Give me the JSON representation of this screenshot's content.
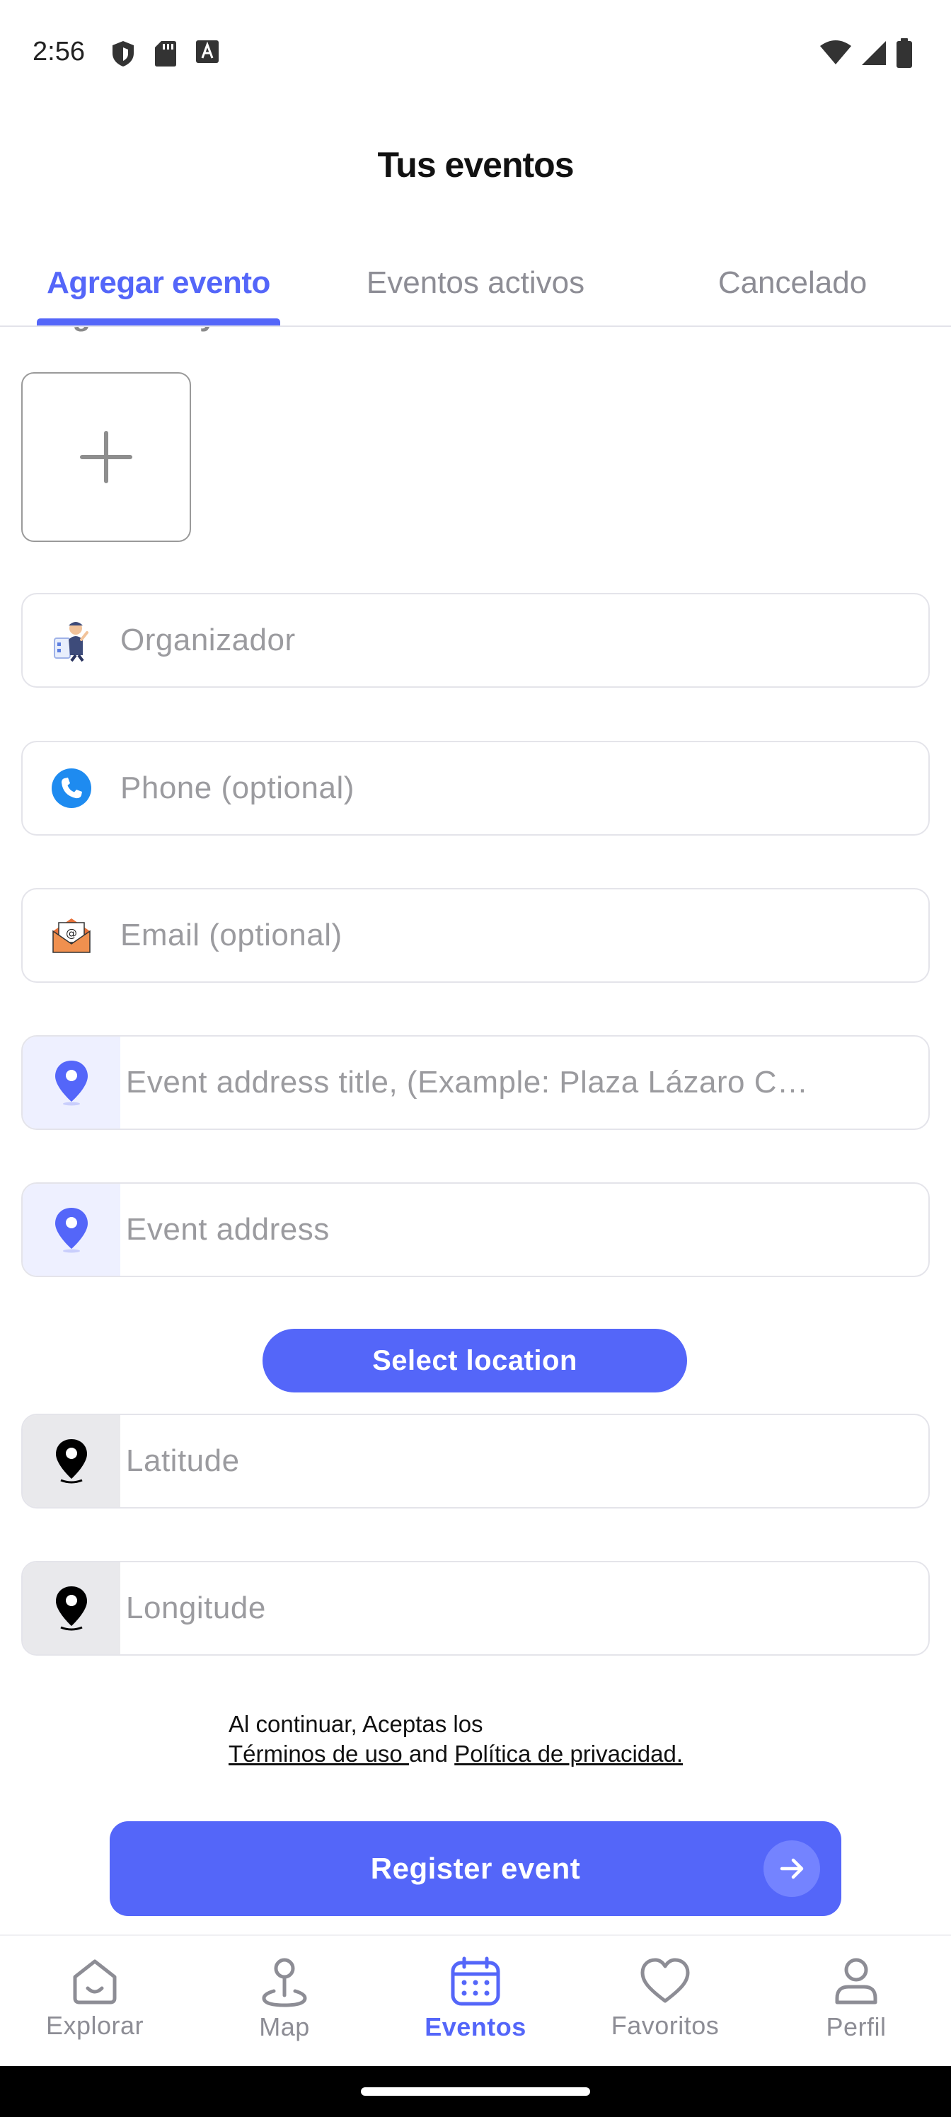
{
  "status_bar": {
    "time": "2:56",
    "left_icons": [
      "shield-icon",
      "sd-card-icon",
      "font-icon"
    ],
    "right_icons": [
      "wifi-icon",
      "signal-icon",
      "battery-icon"
    ]
  },
  "header": {
    "title": "Tus eventos"
  },
  "tabs": [
    {
      "label": "Agregar evento",
      "active": true
    },
    {
      "label": "Eventos activos",
      "active": false
    },
    {
      "label": "Cancelado",
      "active": false
    }
  ],
  "form": {
    "gallery_label": "Image Gallery",
    "add_image_icon": "plus-icon",
    "fields": {
      "organizer": {
        "placeholder": "Organizador",
        "icon": "organizer-icon"
      },
      "phone": {
        "placeholder": "Phone (optional)",
        "icon": "phone-icon"
      },
      "email": {
        "placeholder": "Email (optional)",
        "icon": "email-icon"
      },
      "address_title": {
        "placeholder": "Event address title, (Example: Plaza Lázaro C…",
        "icon": "location-pin-icon"
      },
      "address": {
        "placeholder": "Event address",
        "icon": "location-pin-icon"
      },
      "latitude": {
        "placeholder": "Latitude",
        "icon": "map-pin-icon"
      },
      "longitude": {
        "placeholder": "Longitude",
        "icon": "map-pin-icon"
      }
    },
    "select_location_label": "Select location",
    "terms": {
      "line1": "Al continuar, Aceptas los",
      "terms_link": "Términos de uso ",
      "and": "and ",
      "privacy_link": "Política de privacidad."
    },
    "register_label": "Register event"
  },
  "bottom_nav": [
    {
      "label": "Explorar",
      "icon": "home-icon",
      "active": false
    },
    {
      "label": "Map",
      "icon": "map-pin-icon",
      "active": false
    },
    {
      "label": "Eventos",
      "icon": "calendar-icon",
      "active": true
    },
    {
      "label": "Favoritos",
      "icon": "heart-icon",
      "active": false
    },
    {
      "label": "Perfil",
      "icon": "profile-icon",
      "active": false
    }
  ],
  "colors": {
    "accent": "#5466f9",
    "placeholder": "#9b9b9f",
    "border": "#e4e4ea"
  }
}
